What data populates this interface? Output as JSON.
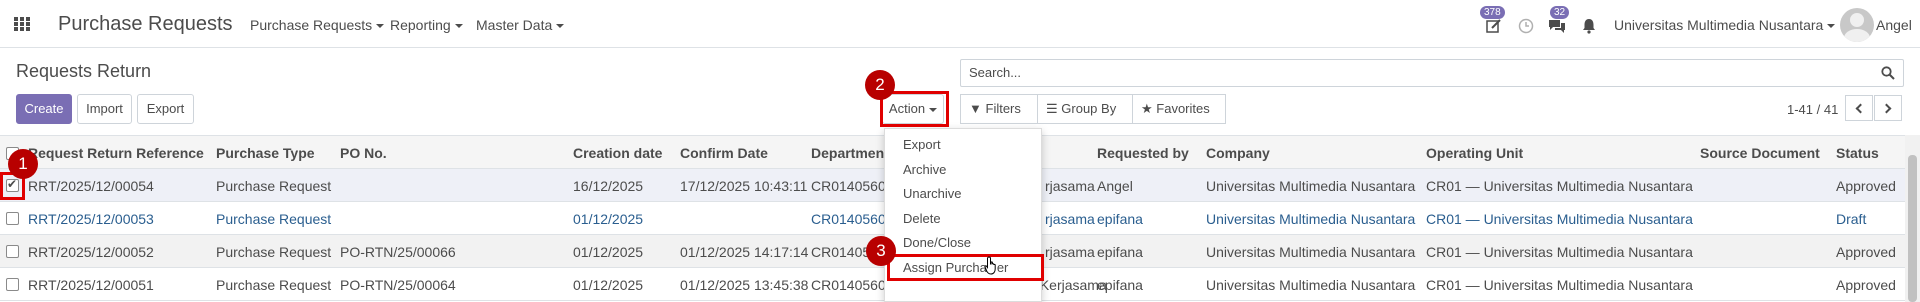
{
  "navbar": {
    "app_title": "Purchase Requests",
    "menus": [
      "Purchase Requests",
      "Reporting",
      "Master Data"
    ],
    "activity_badge": "378",
    "messages_badge": "32",
    "company": "Universitas Multimedia Nusantara",
    "user": "Angel"
  },
  "control_panel": {
    "breadcrumb": "Requests Return",
    "create_label": "Create",
    "import_label": "Import",
    "export_label": "Export",
    "action_label": "Action",
    "search_placeholder": "Search...",
    "filters_label": "Filters",
    "group_by_label": "Group By",
    "favorites_label": "Favorites",
    "pager": "1-41 / 41"
  },
  "table": {
    "columns": [
      "Request Return Reference",
      "Purchase Type",
      "PO No.",
      "Creation date",
      "Confirm Date",
      "Department",
      "Requested by",
      "Company",
      "Operating Unit",
      "Source Document",
      "Status"
    ],
    "rows": [
      {
        "ref": "RRT/2025/12/00054",
        "type": "Purchase Request",
        "po": "",
        "created": "16/12/2025",
        "confirm": "17/12/2025 10:43:11",
        "dept": "CR01405600",
        "dept_tail": "rjasama",
        "requested": "Angel",
        "company": "Universitas Multimedia Nusantara",
        "unit": "CR01 — Universitas Multimedia Nusantara",
        "source": "",
        "status": "Approved"
      },
      {
        "ref": "RRT/2025/12/00053",
        "type": "Purchase Request",
        "po": "",
        "created": "01/12/2025",
        "confirm": "",
        "dept": "CR01405600",
        "dept_tail": "rjasama",
        "requested": "epifana",
        "company": "Universitas Multimedia Nusantara",
        "unit": "CR01 — Universitas Multimedia Nusantara",
        "source": "",
        "status": "Draft"
      },
      {
        "ref": "RRT/2025/12/00052",
        "type": "Purchase Request",
        "po": "PO-RTN/25/00066",
        "created": "01/12/2025",
        "confirm": "01/12/2025 14:17:14",
        "dept": "CR01405",
        "dept_tail": "rjasama",
        "requested": "epifana",
        "company": "Universitas Multimedia Nusantara",
        "unit": "CR01 — Universitas Multimedia Nusantara",
        "source": "",
        "status": "Approved"
      },
      {
        "ref": "RRT/2025/12/00051",
        "type": "Purchase Request",
        "po": "PO-RTN/25/00064",
        "created": "01/12/2025",
        "confirm": "01/12/2025 13:45:38",
        "dept": "CR01405600 — Biro Hubungan dan Kerjasama",
        "dept_tail": "",
        "requested": "epifana",
        "company": "Universitas Multimedia Nusantara",
        "unit": "CR01 — Universitas Multimedia Nusantara",
        "source": "",
        "status": "Approved"
      }
    ]
  },
  "action_menu": {
    "items": [
      "Export",
      "Archive",
      "Unarchive",
      "Delete",
      "Done/Close",
      "Assign Purchaser"
    ],
    "visible_assign_label": "Assign Purcha",
    "visible_assign_tail": "er"
  },
  "annotations": {
    "markers": [
      "1",
      "2",
      "3"
    ],
    "highlight_color": "#e00000"
  },
  "colors": {
    "primary": "#7a6eb4",
    "link": "#2a5e8f"
  }
}
